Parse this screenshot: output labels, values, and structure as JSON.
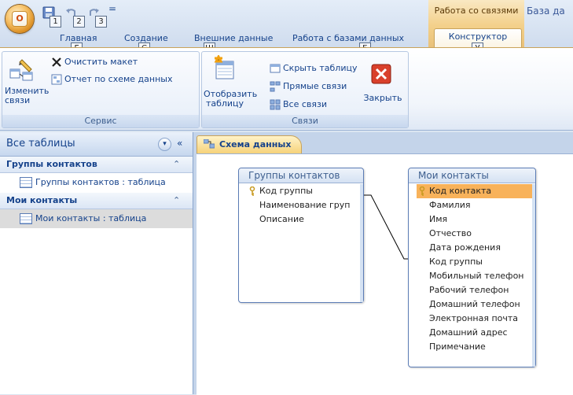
{
  "qat": {
    "office_logo": "O",
    "keytips": [
      "1",
      "2",
      "3"
    ],
    "dropdown": "="
  },
  "contextual": {
    "group_label": "Работа со связями",
    "db_title": "База да"
  },
  "tabs": [
    {
      "label": "Главная",
      "keytip": "Г"
    },
    {
      "label": "Создание",
      "keytip": "С"
    },
    {
      "label": "Внешние данные",
      "keytip": "Ш"
    },
    {
      "label": "Работа с базами данных",
      "keytip": "Б"
    },
    {
      "label": "Конструктор",
      "keytip": "У",
      "active": true
    }
  ],
  "ribbon": {
    "service": {
      "label": "Сервис",
      "edit_links": "Изменить связи",
      "clear_layout": "Очистить макет",
      "report": "Отчет по схеме данных"
    },
    "links": {
      "label": "Связи",
      "show_table": "Отобразить таблицу",
      "hide_table": "Скрыть таблицу",
      "direct_links": "Прямые связи",
      "all_links": "Все связи",
      "close": "Закрыть"
    }
  },
  "nav": {
    "title": "Все таблицы",
    "dropdown": "▾",
    "collapse": "«",
    "groups": [
      {
        "label": "Группы контактов",
        "chev": "⌃",
        "item": "Группы контактов : таблица"
      },
      {
        "label": "Мои контакты",
        "chev": "⌃",
        "item": "Мои контакты : таблица"
      }
    ]
  },
  "document": {
    "tab_label": "Схема данных",
    "tables": [
      {
        "title": "Группы контактов",
        "fields": [
          "Код группы",
          "Наименование груп",
          "Описание"
        ]
      },
      {
        "title": "Мои контакты",
        "fields": [
          "Код контакта",
          "Фамилия",
          "Имя",
          "Отчество",
          "Дата рождения",
          "Код группы",
          "Мобильный телефон",
          "Рабочий телефон",
          "Домашний телефон",
          "Электронная почта",
          "Домашний адрес",
          "Примечание"
        ]
      }
    ]
  }
}
